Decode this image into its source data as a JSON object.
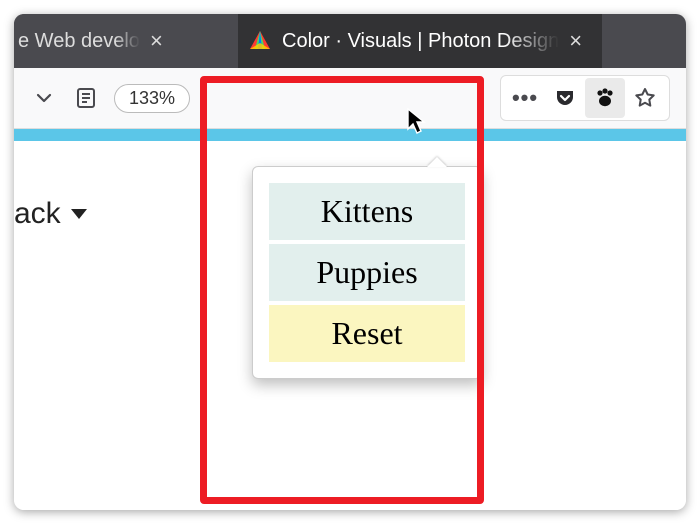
{
  "tabs": [
    {
      "label": "e Web develo"
    },
    {
      "label": "Color · Visuals | Photon Design"
    }
  ],
  "toolbar": {
    "zoom_label": "133%"
  },
  "page": {
    "visible_text": "ack",
    "cyan_accent": "#5bc6e8"
  },
  "popup": {
    "items": [
      "Kittens",
      "Puppies"
    ],
    "reset_label": "Reset"
  },
  "highlight_color": "#ed1c24"
}
